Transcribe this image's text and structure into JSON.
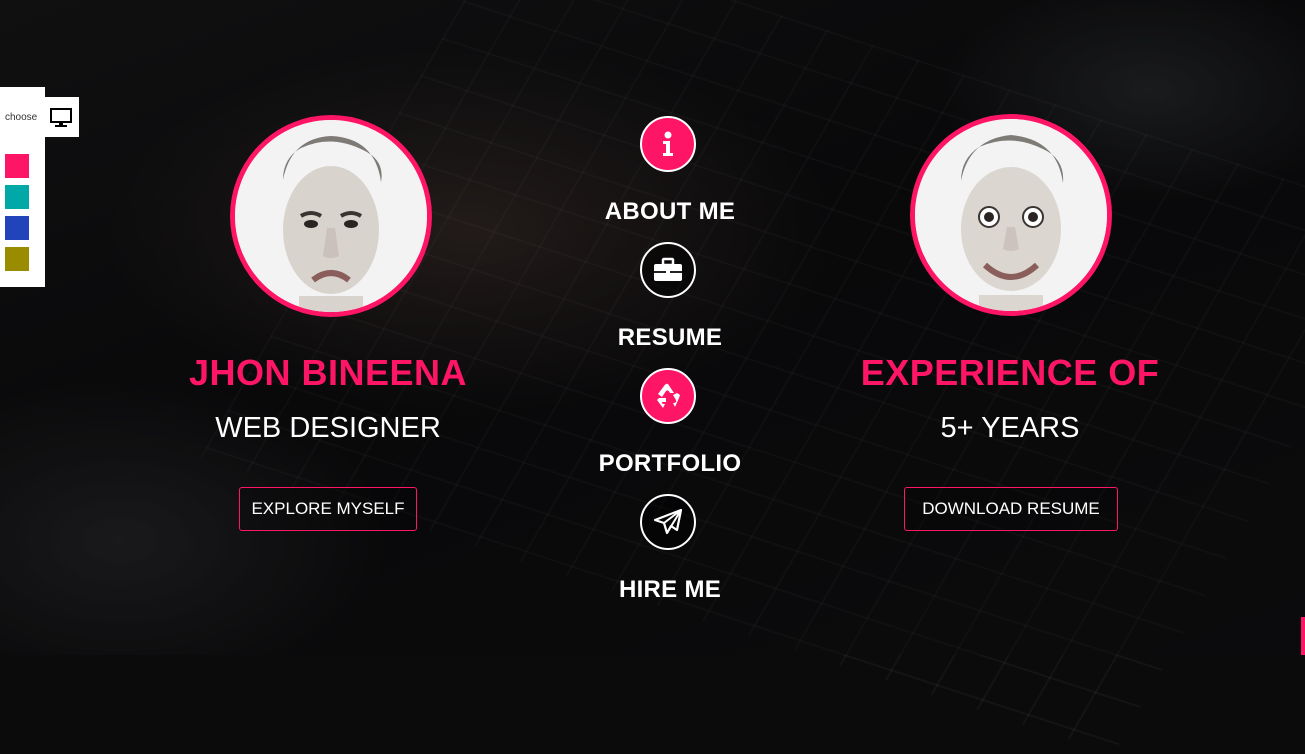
{
  "theme": {
    "accent": "#ff1566",
    "swatches": [
      "#ff1566",
      "#00a8a8",
      "#2244bb",
      "#9a8c00"
    ]
  },
  "switcher": {
    "label": "choose",
    "icon": "monitor-icon"
  },
  "profile": {
    "name": "JHON BINEENA",
    "role": "WEB DESIGNER",
    "button": "EXPLORE MYSELF"
  },
  "experience": {
    "title": "EXPERIENCE OF",
    "years": "5+ YEARS",
    "button": "DOWNLOAD RESUME"
  },
  "nav": [
    {
      "label": "ABOUT ME",
      "icon": "info-icon"
    },
    {
      "label": "RESUME",
      "icon": "briefcase-icon"
    },
    {
      "label": "PORTFOLIO",
      "icon": "recycle-icon"
    },
    {
      "label": "HIRE ME",
      "icon": "paper-plane-icon"
    }
  ]
}
